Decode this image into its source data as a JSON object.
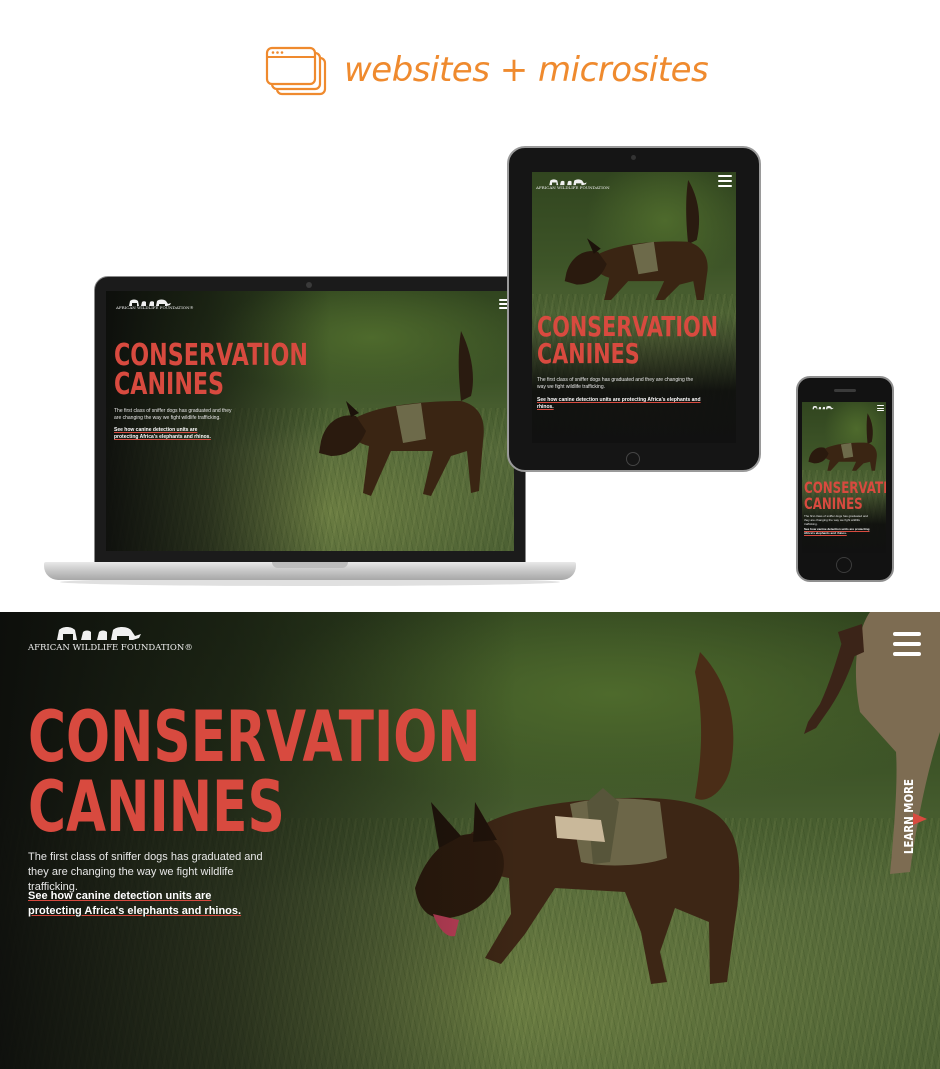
{
  "header": {
    "title": "websites + microsites",
    "icon": "browser-windows-icon",
    "accent_color": "#ef8a2e"
  },
  "brand": {
    "logo_icon": "elephant-family-icon",
    "name": "AFRICAN WILDLIFE FOUNDATION",
    "registered": "®"
  },
  "hero": {
    "headline_line1": "CONSERVATION",
    "headline_line2": "CANINES",
    "description": "The first class of sniffer dogs has graduated and they are changing the way we fight wildlife trafficking.",
    "link_text": "See how canine detection units are protecting Africa's elephants and rhinos.",
    "learn_more": "LEARN MORE",
    "menu_icon": "hamburger-menu-icon",
    "arrow_icon": "arrow-down-icon",
    "headline_color": "#d84a3f"
  },
  "devices": {
    "laptop": "laptop-mockup",
    "tablet": "tablet-mockup",
    "phone": "phone-mockup"
  }
}
